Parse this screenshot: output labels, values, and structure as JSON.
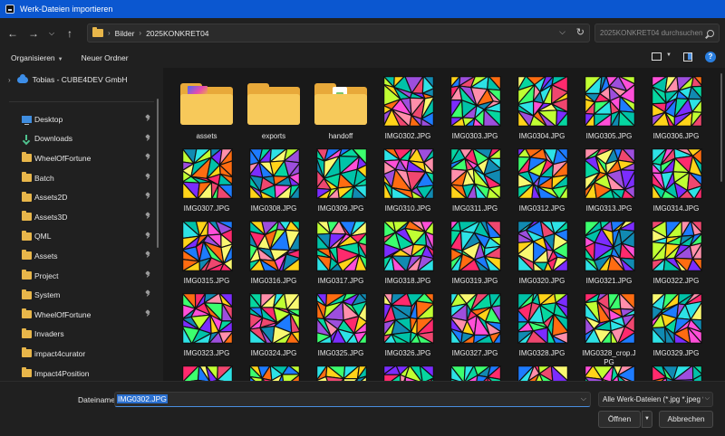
{
  "window": {
    "title": "Werk-Dateien importieren"
  },
  "nav": {
    "breadcrumb": [
      "Bilder",
      "2025KONKRET04"
    ],
    "search_placeholder": "2025KONKRET04 durchsuchen"
  },
  "toolbar": {
    "organize_label": "Organisieren",
    "new_folder_label": "Neuer Ordner"
  },
  "sidebar": {
    "cloud_item": "Tobias - CUBE4DEV GmbH",
    "items": [
      {
        "label": "Desktop",
        "icon": "desktop-icon"
      },
      {
        "label": "Downloads",
        "icon": "downloads-icon"
      },
      {
        "label": "WheelOfFortune",
        "icon": "folder-icon"
      },
      {
        "label": "Batch",
        "icon": "folder-icon"
      },
      {
        "label": "Assets2D",
        "icon": "folder-icon"
      },
      {
        "label": "Assets3D",
        "icon": "folder-icon"
      },
      {
        "label": "QML",
        "icon": "folder-icon"
      },
      {
        "label": "Assets",
        "icon": "folder-icon"
      },
      {
        "label": "Project",
        "icon": "folder-icon"
      },
      {
        "label": "System",
        "icon": "folder-icon"
      },
      {
        "label": "WheelOfFortune",
        "icon": "folder-icon"
      },
      {
        "label": "Invaders",
        "icon": "folder-icon"
      },
      {
        "label": "impact4curator",
        "icon": "folder-icon"
      },
      {
        "label": "Impact4Position",
        "icon": "folder-icon"
      }
    ]
  },
  "files": [
    {
      "name": "assets",
      "kind": "folder"
    },
    {
      "name": "exports",
      "kind": "folder"
    },
    {
      "name": "handoff",
      "kind": "folder"
    },
    {
      "name": "IMG0302.JPG",
      "kind": "image"
    },
    {
      "name": "IMG0303.JPG",
      "kind": "image"
    },
    {
      "name": "IMG0304.JPG",
      "kind": "image"
    },
    {
      "name": "IMG0305.JPG",
      "kind": "image"
    },
    {
      "name": "IMG0306.JPG",
      "kind": "image"
    },
    {
      "name": "IMG0307.JPG",
      "kind": "image"
    },
    {
      "name": "IMG0308.JPG",
      "kind": "image"
    },
    {
      "name": "IMG0309.JPG",
      "kind": "image"
    },
    {
      "name": "IMG0310.JPG",
      "kind": "image"
    },
    {
      "name": "IMG0311.JPG",
      "kind": "image"
    },
    {
      "name": "IMG0312.JPG",
      "kind": "image"
    },
    {
      "name": "IMG0313.JPG",
      "kind": "image"
    },
    {
      "name": "IMG0314.JPG",
      "kind": "image"
    },
    {
      "name": "IMG0315.JPG",
      "kind": "image"
    },
    {
      "name": "IMG0316.JPG",
      "kind": "image"
    },
    {
      "name": "IMG0317.JPG",
      "kind": "image"
    },
    {
      "name": "IMG0318.JPG",
      "kind": "image"
    },
    {
      "name": "IMG0319.JPG",
      "kind": "image"
    },
    {
      "name": "IMG0320.JPG",
      "kind": "image"
    },
    {
      "name": "IMG0321.JPG",
      "kind": "image"
    },
    {
      "name": "IMG0322.JPG",
      "kind": "image"
    },
    {
      "name": "IMG0323.JPG",
      "kind": "image"
    },
    {
      "name": "IMG0324.JPG",
      "kind": "image"
    },
    {
      "name": "IMG0325.JPG",
      "kind": "image"
    },
    {
      "name": "IMG0326.JPG",
      "kind": "image"
    },
    {
      "name": "IMG0327.JPG",
      "kind": "image"
    },
    {
      "name": "IMG0328.JPG",
      "kind": "image"
    },
    {
      "name": "IMG0328_crop.JPG",
      "kind": "image"
    },
    {
      "name": "IMG0329.JPG",
      "kind": "image"
    }
  ],
  "footer": {
    "filename_label": "Dateiname:",
    "filename_value": "IMG0302.JPG",
    "filter_value": "Alle Werk-Dateien (*.jpg *.jpeg *",
    "open_label": "Öffnen",
    "cancel_label": "Abbrechen"
  },
  "colors": {
    "titlebar": "#0b57d0",
    "accent": "#2a6fcf",
    "folder": "#f7c95a",
    "thumb_palette": [
      "#ff2a6d",
      "#ffd319",
      "#2de2e6",
      "#7b2cff",
      "#ff6c11",
      "#3cff6e",
      "#1d7bff",
      "#ff4fd8",
      "#f9f871",
      "#00c2a8",
      "#ff8fab",
      "#9d4edd",
      "#06d6a0",
      "#ef476f",
      "#118ab2",
      "#c0ff33"
    ]
  }
}
